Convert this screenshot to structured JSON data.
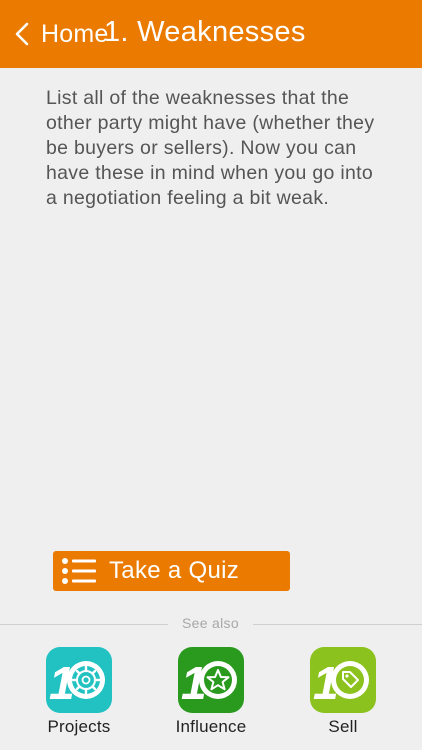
{
  "navbar": {
    "back_label": "Home",
    "title": "1. Weaknesses",
    "background_color": "#ea7a00"
  },
  "content": {
    "body": "List all of the weaknesses that the other party might have (whether they be buyers or sellers).  Now you can have these in mind when you go into a negotiation feeling a bit weak."
  },
  "quiz_button": {
    "label": "Take a Quiz",
    "icon": "list-icon",
    "color": "#ea7a00"
  },
  "see_also": {
    "label": "See also",
    "apps": [
      {
        "label": "Projects",
        "icon": "gear-icon",
        "color": "#22c2c2"
      },
      {
        "label": "Influence",
        "icon": "star-icon",
        "color": "#2a9a1f"
      },
      {
        "label": "Sell",
        "icon": "tag-icon",
        "color": "#8cc21e"
      }
    ]
  }
}
